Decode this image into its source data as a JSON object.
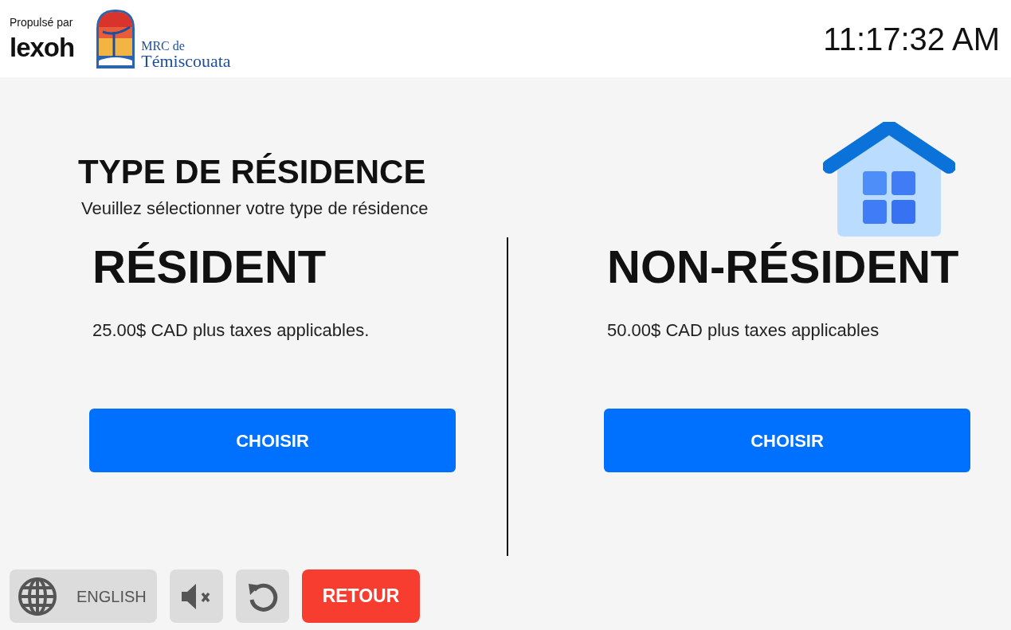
{
  "header": {
    "powered_by": "Propulsé par",
    "brand": "lexoh",
    "logo_line_1": "MRC de",
    "logo_line_2": "Témiscouata",
    "clock": "11:17:32 AM"
  },
  "page": {
    "title": "TYPE DE RÉSIDENCE",
    "subtitle": "Veuillez sélectionner votre type de résidence"
  },
  "options": [
    {
      "name": "RÉSIDENT",
      "price": "25.00$ CAD plus taxes applicables.",
      "button": "CHOISIR"
    },
    {
      "name": "NON-RÉSIDENT",
      "price": "50.00$ CAD plus taxes applicables",
      "button": "CHOISIR"
    }
  ],
  "footer": {
    "language": "ENGLISH",
    "back": "RETOUR"
  }
}
